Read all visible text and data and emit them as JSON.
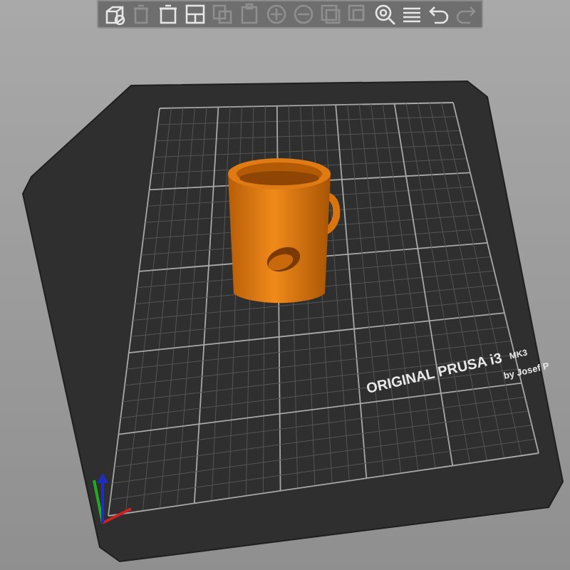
{
  "toolbar": [
    {
      "kind": "add",
      "disabled": false
    },
    {
      "kind": "delete",
      "disabled": true
    },
    {
      "kind": "delete_all",
      "disabled": false
    },
    {
      "kind": "arrange",
      "disabled": false
    },
    {
      "kind": "copy",
      "disabled": true
    },
    {
      "kind": "paste",
      "disabled": true
    },
    {
      "kind": "add_instance",
      "disabled": true
    },
    {
      "kind": "remove_instance",
      "disabled": true
    },
    {
      "kind": "split_objects",
      "disabled": true
    },
    {
      "kind": "split_parts",
      "disabled": true
    },
    {
      "kind": "search",
      "disabled": false
    },
    {
      "kind": "layers",
      "disabled": false
    },
    {
      "kind": "undo",
      "disabled": false
    },
    {
      "kind": "redo",
      "disabled": true
    }
  ],
  "bed_texture": {
    "title": "ORIGINAL PRUSA i3",
    "model": "MK3",
    "byline": "by Josef P"
  }
}
